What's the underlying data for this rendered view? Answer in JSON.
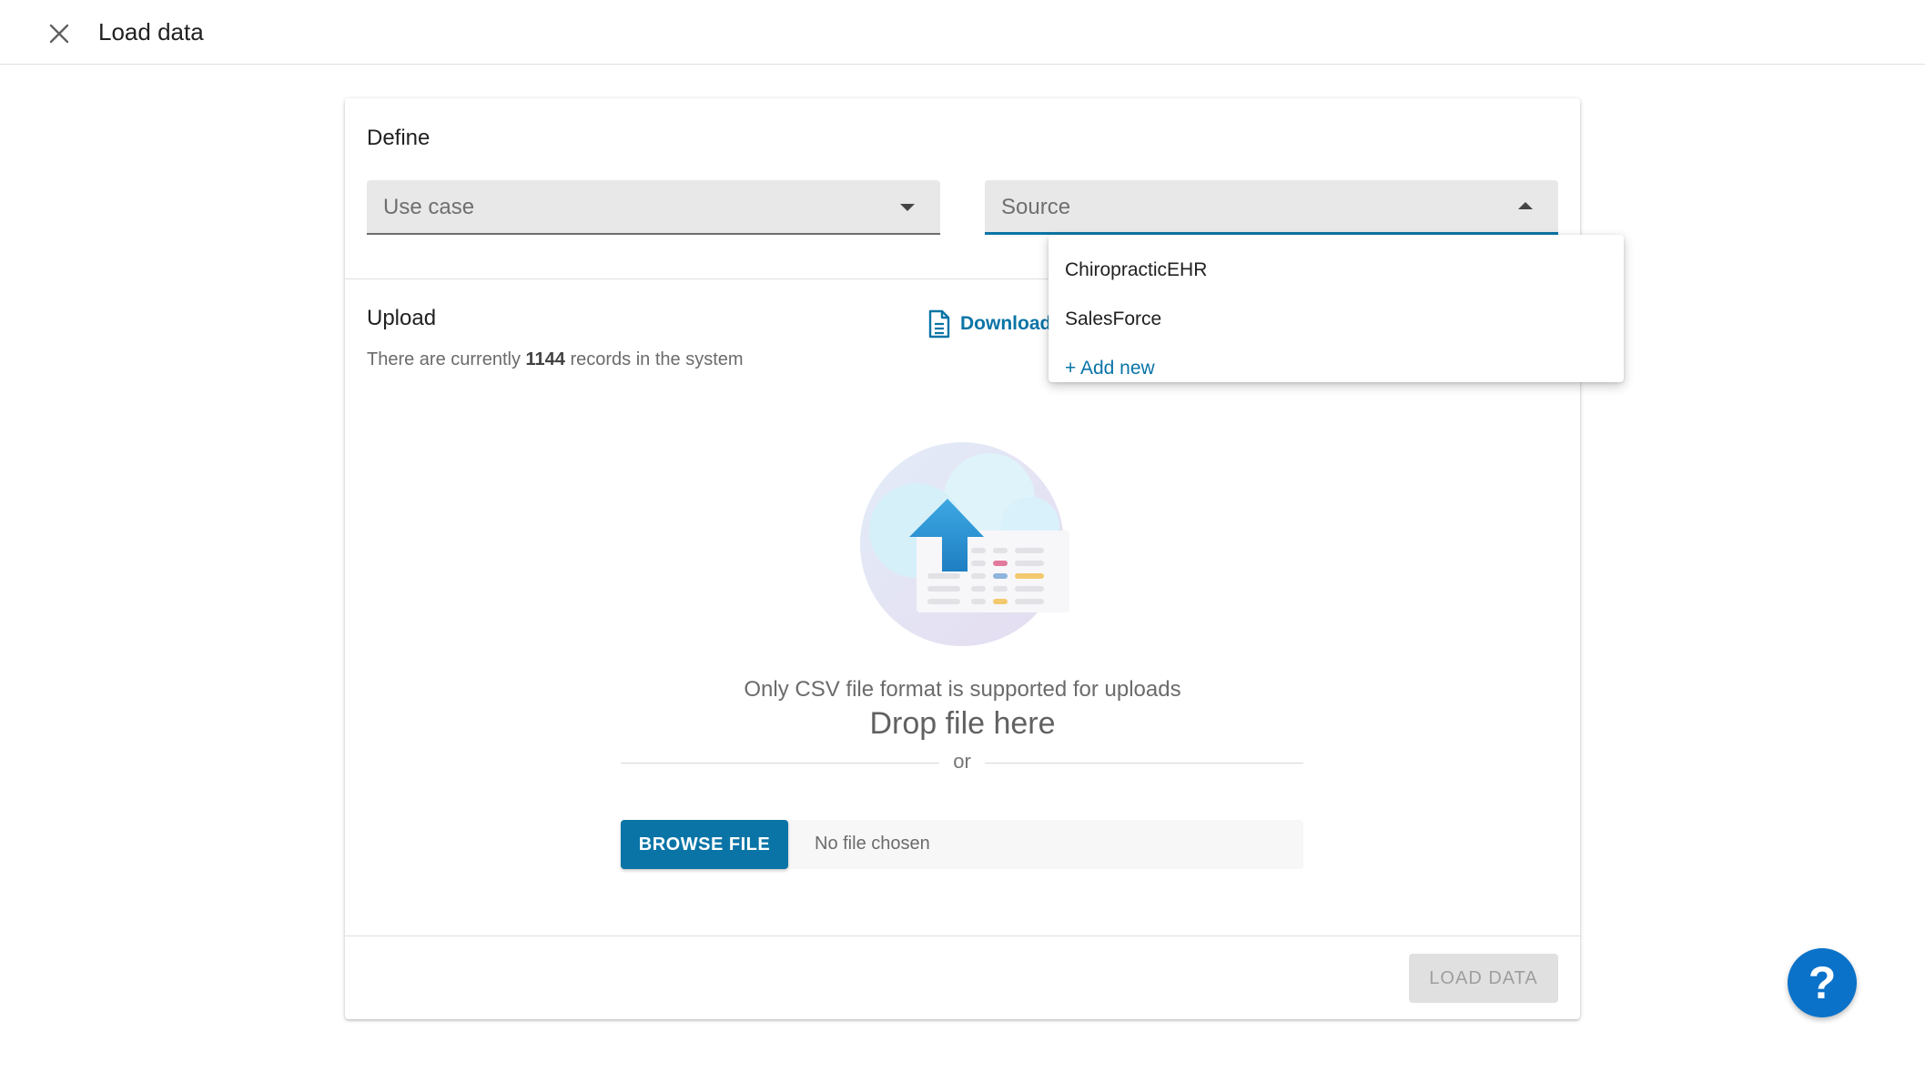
{
  "header": {
    "title": "Load data",
    "close_icon": "close-icon"
  },
  "define": {
    "title": "Define",
    "use_case": {
      "label": "Use case"
    },
    "source": {
      "label": "Source",
      "expanded": true
    }
  },
  "source_menu": {
    "items": [
      "ChiropracticEHR",
      "SalesForce"
    ],
    "add_new": "+ Add new"
  },
  "upload": {
    "title": "Upload",
    "records_prefix": "There are currently",
    "records_count": "1144",
    "records_suffix": "records in the system",
    "download_label": "Download",
    "only_csv": "Only CSV file format is supported for uploads",
    "drop_here": "Drop file here",
    "or": "or",
    "browse_label": "BROWSE FILE",
    "no_file": "No file chosen"
  },
  "footer": {
    "load_label": "LOAD DATA"
  },
  "help": {
    "label": "?"
  },
  "colors": {
    "accent": "#0a74a6",
    "help": "#0a72c9",
    "select_bg": "#e8e8e8"
  }
}
